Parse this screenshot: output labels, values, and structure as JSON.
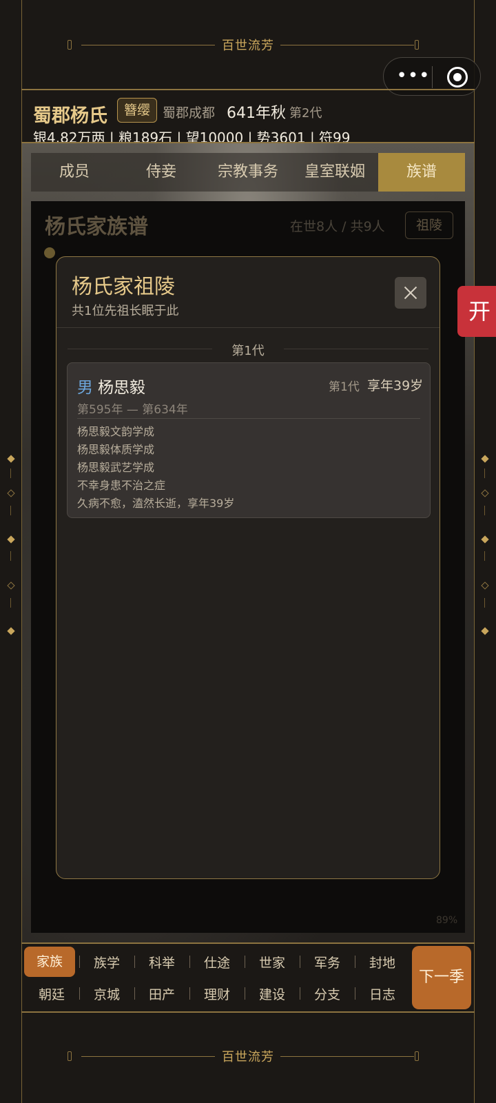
{
  "banner": {
    "title": "百世流芳"
  },
  "capsule": {
    "more_icon": "more-dots-icon",
    "close_icon": "target-icon"
  },
  "header": {
    "family_name": "蜀郡杨氏",
    "rank": "簪缨",
    "location": "蜀郡成都",
    "year": "641年秋",
    "generation": "第2代",
    "resources": "银4.82万两 | 粮189石 | 望10000 | 势3601 | 符99"
  },
  "tabs": [
    {
      "label": "成员",
      "active": false
    },
    {
      "label": "侍妾",
      "active": false
    },
    {
      "label": "宗教事务",
      "active": false
    },
    {
      "label": "皇室联姻",
      "active": false
    },
    {
      "label": "族谱",
      "active": true
    }
  ],
  "panel": {
    "title": "杨氏家族谱",
    "count": "在世8人 / 共9人",
    "tomb_button": "祖陵",
    "zoom": "89%"
  },
  "side_tag": {
    "label": "开"
  },
  "modal": {
    "title": "杨氏家祖陵",
    "subtitle": "共1位先祖长眠于此",
    "close_icon": "close-icon",
    "generation_header": "第1代",
    "ancestor": {
      "gender": "男",
      "name": "杨思毅",
      "generation": "第1代",
      "age": "享年39岁",
      "years": "第595年 — 第634年",
      "events": [
        "杨思毅文韵学成",
        "杨思毅体质学成",
        "杨思毅武艺学成",
        "不幸身患不治之症",
        "久病不愈，溘然长逝，享年39岁"
      ]
    }
  },
  "bottom_nav": {
    "row1": [
      "家族",
      "族学",
      "科举",
      "仕途",
      "世家",
      "军务",
      "封地"
    ],
    "row2": [
      "朝廷",
      "京城",
      "田产",
      "理财",
      "建设",
      "分支",
      "日志"
    ],
    "active": "家族",
    "next_button": "下一季"
  },
  "colors": {
    "accent_gold": "#c9a65c",
    "active_orange": "#b8692a",
    "male_blue": "#6da7dd",
    "alert_red": "#c8323a"
  }
}
